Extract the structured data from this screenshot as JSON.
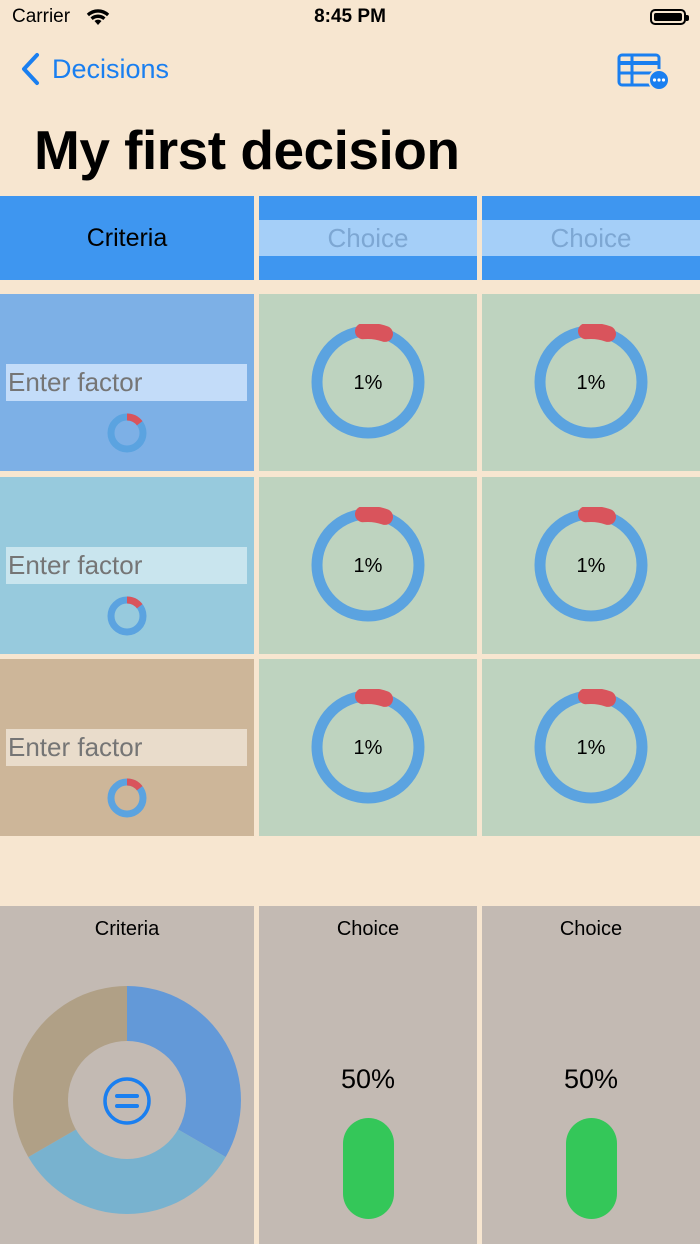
{
  "status_bar": {
    "carrier": "Carrier",
    "time": "8:45 PM"
  },
  "nav": {
    "back_label": "Decisions",
    "table_icon": "table-options-icon"
  },
  "page": {
    "title": "My first decision"
  },
  "header": {
    "criteria_label": "Criteria",
    "choices": [
      {
        "placeholder": "Choice",
        "value": ""
      },
      {
        "placeholder": "Choice",
        "value": ""
      }
    ]
  },
  "factors": [
    {
      "placeholder": "Enter factor",
      "value": "",
      "bg_color": "#7db0e6",
      "input_bg": "#c3dcf9",
      "scores": [
        "1%",
        "1%"
      ]
    },
    {
      "placeholder": "Enter factor",
      "value": "",
      "bg_color": "#97cadd",
      "input_bg": "#c9e5ee",
      "scores": [
        "1%",
        "1%"
      ]
    },
    {
      "placeholder": "Enter factor",
      "value": "",
      "bg_color": "#cdb699",
      "input_bg": "#e9dccb",
      "scores": [
        "1%",
        "1%"
      ]
    }
  ],
  "summary": {
    "criteria_title": "Criteria",
    "equal_icon": "equals-circle-icon",
    "criteria_pie_colors": [
      "#6399d8",
      "#78b2cf",
      "#b0a086"
    ],
    "choices": [
      {
        "title": "Choice",
        "percent": "50%"
      },
      {
        "title": "Choice",
        "percent": "50%"
      }
    ]
  },
  "colors": {
    "accent": "#1a7ff0",
    "header_blue": "#3e96f0",
    "ring_blue": "#5ba3e0",
    "ring_red": "#d9545c",
    "green": "#34c759"
  }
}
